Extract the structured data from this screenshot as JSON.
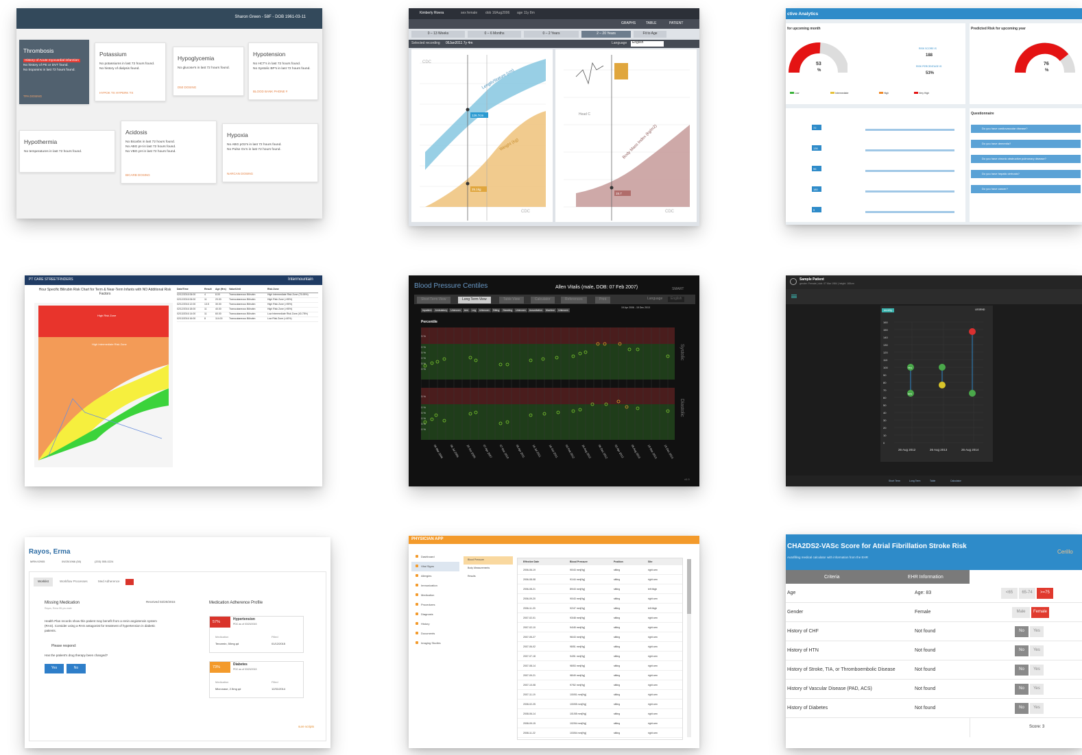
{
  "tile1": {
    "header": "Sharon Green - 58F - DOB 1961-03-11",
    "cards": [
      {
        "title": "Thrombosis",
        "highlight": "History of Acute myocardial infarction",
        "lines": [
          "No history of PE or DVT found.",
          "No troponins in last 72 hours found."
        ],
        "action": "TPA DOSING"
      },
      {
        "title": "Potassium",
        "lines": [
          "No potassiums in last 72 hours found.",
          "No history of dialysis found."
        ],
        "action": "HYPOK TX    HYPERK TX"
      },
      {
        "title": "Hypoglycemia",
        "lines": [
          "No glucose's in last 72 hours found."
        ],
        "action": "D50 DOSING"
      },
      {
        "title": "Hypotension",
        "lines": [
          "No HCT's in last 72 hours found.",
          "No Systolic BP's in last 72 hours found."
        ],
        "action": "BLOOD BANK PHONE #"
      },
      {
        "title": "Hypothermia",
        "lines": [
          "No temperatures in last 72 hours found."
        ],
        "action": ""
      },
      {
        "title": "Acidosis",
        "lines": [
          "No Bicarbs in last 72 hours found.",
          "No ABG pH in last 72 hours found.",
          "No VBG pH in last 72 hours found."
        ],
        "action": "BICARB DOSING"
      },
      {
        "title": "Hypoxia",
        "lines": [
          "No ABG pO2's in last 72 hours found.",
          "No Pulse Ox's in last 72 hours found."
        ],
        "action": "NARCAN DOSING"
      }
    ]
  },
  "tile2": {
    "patient": "Kimberly Rivera",
    "sex": "sex female",
    "dob": "dob 16Aug2006",
    "age": "age 11y 8m",
    "tabs": [
      "0 – 13 Weeks",
      "0 – 6 Months",
      "0 – 2 Years",
      "2 – 20 Years",
      "Fit to Age"
    ],
    "date_label": "Selected recording",
    "date": "06Jan2011 7y 4m",
    "language_label": "Language",
    "language": "English",
    "btn_graphs": "GRAPHS",
    "btn_table": "TABLE",
    "btn_patient": "PATIENT",
    "chart_stature": "Length/Stature (cm)",
    "chart_weight": "Weight (kg)",
    "chart_bmi": "Body Mass Index (kg/m2)",
    "chart_head": "Head C",
    "src": "CDC",
    "val_stature": "126.7cm",
    "val_weight": "25.1kg",
    "val_bmi": "15.7"
  },
  "tile3": {
    "title": "ctive Analytics",
    "left_panel": "for upcoming month",
    "right_panel": "Predicted Risk for upcoming year",
    "gauge_left": "53",
    "gauge_right": "76",
    "pct": "%",
    "risk_score_label": "RISK SCORE IS",
    "risk_score": "188",
    "risk_pct_label": "RISK PERCENTAGE IS",
    "risk_pct": "53%",
    "legend": [
      "Low",
      "Intermediate",
      "High",
      "Very High"
    ],
    "questionnaire": "Questionnaire",
    "questions": [
      "Do you have cardiovascular disease?",
      "Do you have dementia?",
      "Do you have chronic obstructive pulmonary disease?",
      "Do you have hepatic cirrhosis?",
      "Do you have cancer?"
    ],
    "values": [
      "72",
      "136",
      "96",
      "180",
      "5"
    ],
    "units": [
      "bpm",
      "mm Hg",
      "mg/dL",
      "mEq/L",
      "mg/dL"
    ]
  },
  "tile4": {
    "app": "PT CARE STREETFINDERS",
    "brand": "Intermountain",
    "chart_title": "Hour Specific Bilirubin Risk Chart for Term & Near-Term Infants with NO Additional Risk Factors",
    "zones": [
      "High Risk Zone",
      "High Intermediate Risk Zone",
      "Low Intermediate Risk Zone",
      "Low Risk Zone"
    ],
    "table_headers": [
      "Date/Time",
      "Result",
      "Age (Hrs)",
      "Value/Unit",
      "Risk Zone"
    ],
    "rows": [
      [
        "02/12/2016 06:00",
        "4",
        "8.00",
        "Transcutaneous Bilirubin",
        "High Intermediate Risk Zone (75-95%)"
      ],
      [
        "02/12/2016 06:00",
        "11",
        "20.00",
        "Transcutaneous Bilirubin",
        "High Risk Zone (>95%)"
      ],
      [
        "02/12/2016 12:00",
        "13.5",
        "30.00",
        "Transcutaneous Bilirubin",
        "High Risk Zone (>95%)"
      ],
      [
        "02/12/2016 18:00",
        "11",
        "40.00",
        "Transcutaneous Bilirubin",
        "High Risk Zone (>95%)"
      ],
      [
        "02/13/2016 14:00",
        "11",
        "60.00",
        "Transcutaneous Bilirubin",
        "Low Intermediate Risk Zone (40-75%)"
      ],
      [
        "02/13/2016 16:00",
        "8",
        "114.00",
        "Transcutaneous Bilirubin",
        "Low Risk Zone (<40%)"
      ]
    ]
  },
  "tile5": {
    "title": "Blood Pressure Centiles",
    "patient": "Allen Vitalis (male, DOB: 07 Feb 2007)",
    "brand": "SMART",
    "tabs": [
      "Short Term View",
      "Long Term View",
      "Table View",
      "Calculator",
      "References",
      "Print"
    ],
    "language_label": "Language",
    "language": "English",
    "filters": [
      "Inpatient",
      "Ambulatory",
      "Unknown",
      "Arm",
      "Leg",
      "Unknown",
      "Sitting",
      "Standing",
      "Unknown",
      "Auscultation",
      "Machine",
      "Unknown"
    ],
    "range": "19 Apr 2006 - 15 Dec 2013",
    "percentile_label": "Percentile",
    "systolic": "Systolic",
    "diastolic": "Diastolic",
    "ticks": [
      "95 %",
      "90 %",
      "75 %",
      "50 %",
      "25 %",
      "10 %"
    ],
    "dates": [
      "06 Mar 2006",
      "06 Jul 2006",
      "20 Oct 2006",
      "07 Apr 2007",
      "07 Nov 2010",
      "05 Apr 2011",
      "18 Jul 2011",
      "18 Oct 2011",
      "03 Feb 2012",
      "26 Aug 2012",
      "06 Dec 2012",
      "02 Apr 2013",
      "05 Aug 2013",
      "19 Nov 2013",
      "15 Dec 2013"
    ],
    "version": "v0.9"
  },
  "tile6": {
    "patient": "Sample Patient",
    "patient_meta": "gender: Female | dob: 07 Mar 1984 | height: 165cm",
    "toggle": "mmHg",
    "legend": "LEGEND",
    "yticks": [
      "160",
      "150",
      "140",
      "130",
      "120",
      "110",
      "100",
      "90",
      "80",
      "70",
      "60",
      "50",
      "40",
      "30",
      "20",
      "10",
      "0"
    ],
    "dates": [
      "26 Aug 2012",
      "26 Aug 2013",
      "26 Aug 2014"
    ],
    "nav": [
      "Short Term",
      "Long Term",
      "Table",
      "Calculator"
    ],
    "badges": [
      "75%",
      "60%"
    ]
  },
  "tile7": {
    "name": "Rayos, Erma",
    "mrn": "MRN:92905",
    "dob": "09/25/1966 (50)",
    "phone": "(203) 555-0224",
    "tabs": [
      "Worklist",
      "Workflow Processes",
      "Med Adherence"
    ],
    "alert_title": "Missing Medication",
    "alert_sub": "Rayos, Erma 55-yrs-male",
    "received": "Received 02/20/2015",
    "alert_body": "Health Plan records show this patient may benefit from a renin angiotensin system (RAS). Consider using a RAS antagonist for treatment of hypertension in diabetic patients.",
    "respond": "Please respond:",
    "question": "Has the patient's drug therapy been changed?",
    "yes": "Yes",
    "no": "No",
    "profile_title": "Medication Adherence Profile",
    "cond1": {
      "pct": "57%",
      "name": "Hypertension",
      "pdc": "PDC as of 03/20/2015",
      "med_label": "Medication",
      "filled_label": "Filled",
      "med": "Tenormin, 50mg qd",
      "filled": "01/12/2015"
    },
    "cond2": {
      "pct": "73%",
      "name": "Diabetes",
      "pdc": "PDC as of 03/20/2015",
      "med_label": "Medication",
      "filled_label": "Filled",
      "med": "Micronase, 2.5mg qd",
      "filled": "12/31/2014"
    },
    "footer": "sure scripts"
  },
  "tile8": {
    "brand": "PHYSICIAN APP",
    "nav": [
      "Dashboard",
      "Vital Signs",
      "Allergies",
      "Immunization",
      "Medication",
      "Procedures",
      "Diagnosis",
      "History",
      "Documents",
      "Imaging Studies"
    ],
    "subnav": [
      "Blood Pressure",
      "Body Measurements",
      "Results"
    ],
    "headers": [
      "Effective Date",
      "Blood Pressure",
      "Position",
      "Site"
    ],
    "rows": [
      [
        "2006-06-19",
        "90/43 mm[Hg]",
        "sitting",
        "right arm"
      ],
      [
        "2006-08-08",
        "91/44 mm[Hg]",
        "sitting",
        "right arm"
      ],
      [
        "2006-08-21",
        "89/43 mm[Hg]",
        "sitting",
        "left thigh"
      ],
      [
        "2006-09-20",
        "90/43 mm[Hg]",
        "sitting",
        "right arm"
      ],
      [
        "2006-11-20",
        "92/47 mm[Hg]",
        "sitting",
        "left thigh"
      ],
      [
        "2007-02-01",
        "93/48 mm[Hg]",
        "sitting",
        "right arm"
      ],
      [
        "2007-02-10",
        "94/45 mm[Hg]",
        "sitting",
        "right arm"
      ],
      [
        "2007-05-27",
        "96/43 mm[Hg]",
        "sitting",
        "right arm"
      ],
      [
        "2007-06-02",
        "98/51 mm[Hg]",
        "sitting",
        "right arm"
      ],
      [
        "2007-07-18",
        "94/51 mm[Hg]",
        "sitting",
        "right arm"
      ],
      [
        "2007-08-14",
        "98/53 mm[Hg]",
        "sitting",
        "right arm"
      ],
      [
        "2007-09-21",
        "98/49 mm[Hg]",
        "sitting",
        "right arm"
      ],
      [
        "2007-10-08",
        "97/52 mm[Hg]",
        "sitting",
        "right arm"
      ],
      [
        "2007-11-19",
        "100/51 mm[Hg]",
        "sitting",
        "right arm"
      ],
      [
        "2008-02-25",
        "100/55 mm[Hg]",
        "sitting",
        "right arm"
      ],
      [
        "2008-06-14",
        "101/55 mm[Hg]",
        "sitting",
        "right arm"
      ],
      [
        "2008-09-15",
        "102/54 mm[Hg]",
        "sitting",
        "right arm"
      ],
      [
        "2008-11-22",
        "103/54 mm[Hg]",
        "sitting",
        "right arm"
      ]
    ]
  },
  "tile9": {
    "title": "CHA2DS2-VASc Score for Atrial Fibrillation Stroke Risk",
    "subtitle": "Autofilling medical calculator with information from the EHR",
    "brand": "Cerillo",
    "col_criteria": "Criteria",
    "col_ehr": "EHR Information",
    "rows": [
      {
        "label": "Age",
        "ehr": "Age: 83"
      },
      {
        "label": "Gender",
        "ehr": "Female"
      },
      {
        "label": "History of CHF",
        "ehr": "Not found"
      },
      {
        "label": "History of HTN",
        "ehr": "Not found"
      },
      {
        "label": "History of Stroke, TIA, or Thromboembolic Disease",
        "ehr": "Not found"
      },
      {
        "label": "History of Vascular Disease (PAD, ACS)",
        "ehr": "Not found"
      },
      {
        "label": "History of Diabetes",
        "ehr": "Not found"
      }
    ],
    "age_opts": [
      "<65",
      "65-74",
      ">=75"
    ],
    "gender_opts": [
      "Male",
      "Female"
    ],
    "no": "No",
    "yes": "Yes",
    "score": "Score: 3"
  },
  "colors": {
    "accent_blue": "#2e8bc9",
    "alert_red": "#e93b32",
    "slate": "#51616f",
    "orange": "#f39a2b"
  }
}
